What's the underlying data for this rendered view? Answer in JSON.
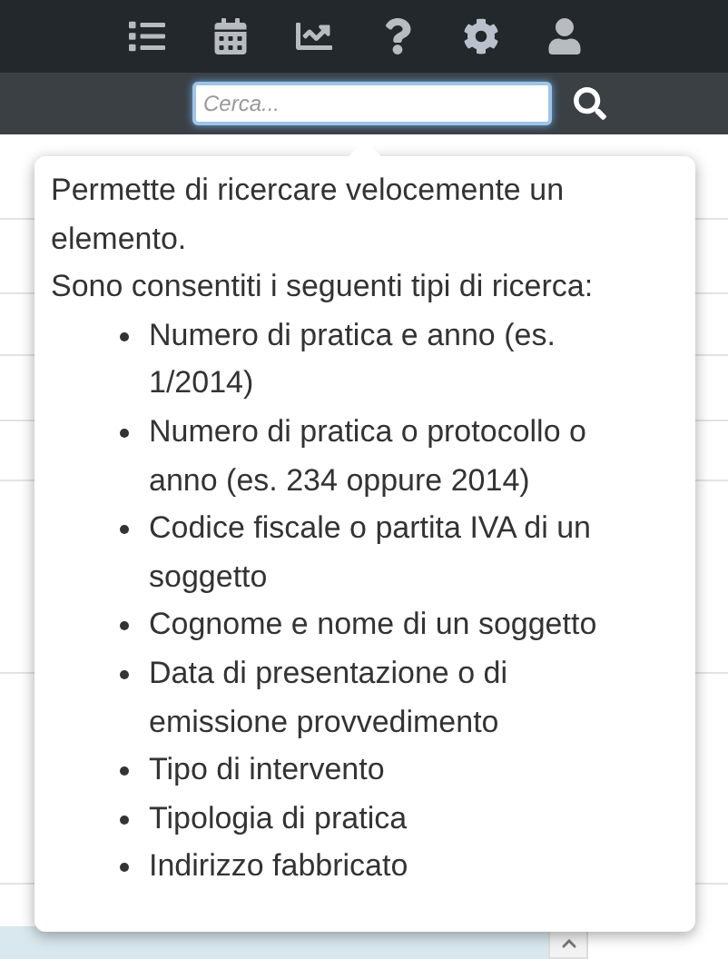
{
  "toolbar": {
    "items": [
      {
        "kind": "list"
      },
      {
        "kind": "calendar"
      },
      {
        "kind": "chart"
      },
      {
        "kind": "help"
      },
      {
        "kind": "settings"
      },
      {
        "kind": "user"
      }
    ]
  },
  "search": {
    "placeholder": "Cerca..."
  },
  "popover": {
    "intro": [
      "Permette di ricercare velocemente un elemento.",
      "Sono consentiti i seguenti tipi di ricerca:"
    ],
    "items": [
      "Numero di pratica e anno (es. 1/2014)",
      "Numero di pratica o protocollo o anno (es. 234 oppure 2014)",
      "Codice fiscale o partita IVA di un soggetto",
      "Cognome e nome di un soggetto",
      "Data di presentazione o di emissione provvedimento",
      "Tipo di intervento",
      "Tipologia di pratica",
      "Indirizzo fabbricato"
    ]
  }
}
